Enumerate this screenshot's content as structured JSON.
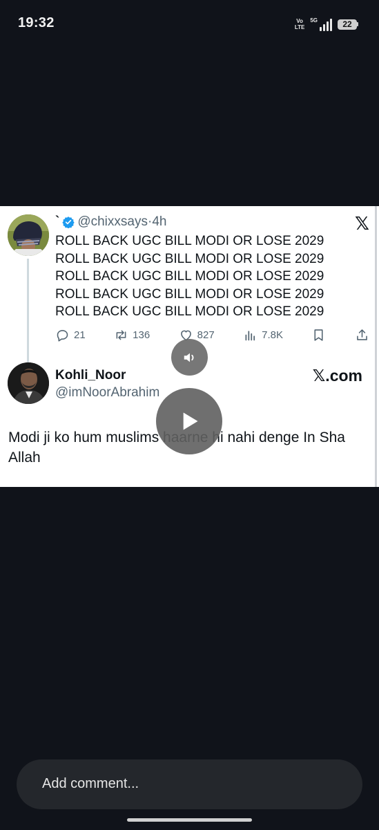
{
  "status_bar": {
    "time": "19:32",
    "volte_top": "Vo",
    "volte_bottom": "LTE",
    "network": "5G",
    "battery": "22"
  },
  "quoted_tweet": {
    "name": "`",
    "handle": "@chixxsays",
    "separator": "·",
    "time": "4h",
    "lines": [
      "ROLL BACK UGC BILL MODI OR LOSE 2029",
      "ROLL BACK UGC BILL MODI OR LOSE 2029",
      "ROLL BACK UGC BILL MODI OR LOSE 2029",
      "ROLL BACK UGC BILL MODI OR LOSE 2029",
      "ROLL BACK UGC BILL MODI OR LOSE 2029"
    ],
    "replies": "21",
    "reposts": "136",
    "likes": "827",
    "views": "7.8K",
    "x_logo": "𝕏"
  },
  "post": {
    "name": "Kohli_Noor",
    "handle": "@imNoorAbrahim",
    "source": "𝕏.com",
    "text": "Modi ji ko hum muslims haarne hi nahi denge In Sha Allah"
  },
  "comment": {
    "placeholder": "Add comment..."
  },
  "colors": {
    "background": "#10131a",
    "card": "#ffffff",
    "verified": "#1d9bf0",
    "comment_bar": "#24272c"
  },
  "icons": [
    "volte-icon",
    "signal-icon",
    "battery-icon",
    "verified-icon",
    "reply-icon",
    "repost-icon",
    "like-icon",
    "views-icon",
    "bookmark-icon",
    "share-icon",
    "volume-icon",
    "play-icon"
  ]
}
